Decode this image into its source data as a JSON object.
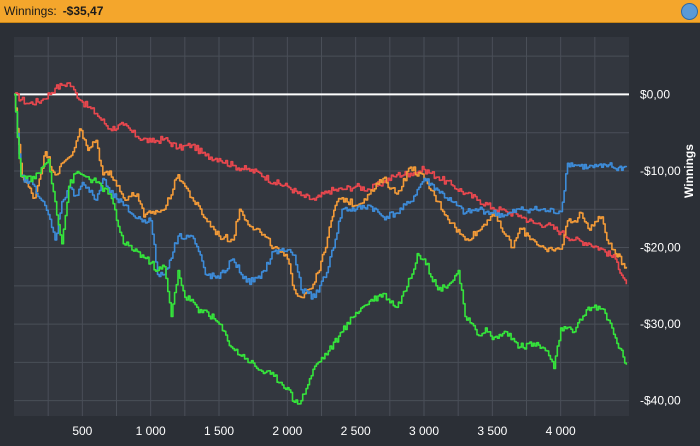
{
  "header": {
    "label": "Winnings:",
    "value": "-$35,47"
  },
  "colors": {
    "background": "#2b2f36",
    "plot_background": "#33373f",
    "grid": "#4a4f58",
    "zero_line": "#ffffff",
    "header": "#f4a62c"
  },
  "chart_data": {
    "type": "line",
    "title": "",
    "xlabel": "",
    "ylabel": "Winnings",
    "xlim": [
      0,
      4500
    ],
    "ylim": [
      -42,
      7.5
    ],
    "xticks": [
      500,
      1000,
      1500,
      2000,
      2500,
      3000,
      3500,
      4000
    ],
    "xtick_labels": [
      "500",
      "1 000",
      "1 500",
      "2 000",
      "2 500",
      "3 000",
      "3 500",
      "4 000"
    ],
    "yticks": [
      0,
      -10,
      -20,
      -30,
      -40
    ],
    "ytick_labels": [
      "$0,00",
      "-$10,00",
      "-$20,00",
      "-$30,00",
      "-$40,00"
    ],
    "grid": true,
    "zero_line": 0,
    "series": [
      {
        "color": "#e8474e",
        "x": [
          0,
          100,
          200,
          300,
          350,
          400,
          450,
          500,
          600,
          700,
          800,
          900,
          1000,
          1100,
          1200,
          1300,
          1400,
          1500,
          1600,
          1700,
          1800,
          1900,
          2000,
          2100,
          2200,
          2300,
          2400,
          2500,
          2600,
          2700,
          2800,
          2900,
          3000,
          3100,
          3200,
          3300,
          3400,
          3500,
          3600,
          3700,
          3800,
          3900,
          4000,
          4100,
          4200,
          4300,
          4400,
          4480
        ],
        "y": [
          0,
          -1.2,
          -0.8,
          0.8,
          1.2,
          1.5,
          0.2,
          -1,
          -2.5,
          -4.5,
          -4,
          -5.5,
          -6.2,
          -5.8,
          -7,
          -6.6,
          -8,
          -8.4,
          -9.3,
          -9.8,
          -10.3,
          -11.5,
          -12,
          -13.2,
          -13.8,
          -12.6,
          -12.4,
          -12,
          -12.4,
          -11.5,
          -10.5,
          -10.3,
          -9.8,
          -10.8,
          -11.8,
          -12.9,
          -13.8,
          -14.8,
          -15.3,
          -15.8,
          -16.8,
          -17,
          -18,
          -19,
          -19.4,
          -20.2,
          -21.5,
          -24.8
        ]
      },
      {
        "color": "#f29a38",
        "x": [
          0,
          60,
          150,
          230,
          300,
          380,
          430,
          480,
          540,
          600,
          650,
          700,
          800,
          900,
          950,
          1000,
          1100,
          1200,
          1250,
          1300,
          1400,
          1500,
          1600,
          1650,
          1700,
          1800,
          1900,
          2000,
          2050,
          2100,
          2150,
          2200,
          2280,
          2320,
          2350,
          2400,
          2500,
          2600,
          2700,
          2800,
          2900,
          3000,
          3100,
          3200,
          3300,
          3400,
          3500,
          3600,
          3650,
          3700,
          3800,
          3900,
          4000,
          4050,
          4100,
          4150,
          4200,
          4300,
          4350,
          4400,
          4480
        ],
        "y": [
          0,
          -10.8,
          -13.5,
          -7.5,
          -10.5,
          -8.5,
          -7.5,
          -4.5,
          -7.3,
          -6,
          -10.5,
          -10,
          -13.5,
          -13,
          -16,
          -15.5,
          -15,
          -10.5,
          -12,
          -13.5,
          -16.2,
          -18.5,
          -19,
          -15,
          -16.5,
          -18,
          -20,
          -21.5,
          -25.5,
          -26.5,
          -25.5,
          -24.5,
          -20,
          -16.5,
          -14.5,
          -13.5,
          -14.5,
          -13,
          -11,
          -13,
          -9.5,
          -11,
          -14,
          -16.8,
          -19,
          -17.8,
          -15.5,
          -18.5,
          -20,
          -17.5,
          -19,
          -20.5,
          -20.2,
          -16.5,
          -16.5,
          -15.5,
          -17.5,
          -16,
          -19.5,
          -20.8,
          -22.5
        ]
      },
      {
        "color": "#3d8bd8",
        "x": [
          0,
          50,
          150,
          250,
          300,
          350,
          400,
          450,
          500,
          600,
          650,
          700,
          800,
          900,
          1000,
          1050,
          1100,
          1200,
          1300,
          1350,
          1400,
          1500,
          1600,
          1700,
          1800,
          1900,
          2000,
          2050,
          2100,
          2200,
          2300,
          2400,
          2500,
          2600,
          2700,
          2800,
          2900,
          3000,
          3100,
          3200,
          3300,
          3400,
          3500,
          3600,
          3700,
          3800,
          3900,
          4000,
          4050,
          4100,
          4200,
          4300,
          4350,
          4400,
          4480
        ],
        "y": [
          0,
          -10.7,
          -12,
          -15.7,
          -19,
          -14,
          -12.2,
          -13.2,
          -11.5,
          -13.8,
          -11,
          -12.8,
          -14.5,
          -16.2,
          -16.5,
          -23.5,
          -23.5,
          -18.5,
          -18.5,
          -20.5,
          -23.5,
          -24,
          -21.5,
          -24.5,
          -24,
          -20.5,
          -20.3,
          -21,
          -25.5,
          -26.5,
          -22.5,
          -15,
          -15,
          -14.5,
          -16,
          -15.5,
          -14,
          -11,
          -12.5,
          -14,
          -15.5,
          -15,
          -15.5,
          -15.8,
          -15,
          -15,
          -15.2,
          -15.3,
          -9,
          -9.2,
          -9.5,
          -9.5,
          -9.2,
          -9.7,
          -9.5
        ]
      },
      {
        "color": "#35e43b",
        "x": [
          0,
          50,
          150,
          250,
          300,
          350,
          400,
          450,
          500,
          600,
          700,
          800,
          900,
          1000,
          1050,
          1100,
          1150,
          1200,
          1250,
          1300,
          1350,
          1400,
          1500,
          1600,
          1700,
          1800,
          1900,
          2000,
          2050,
          2100,
          2200,
          2300,
          2400,
          2500,
          2600,
          2700,
          2800,
          2900,
          2950,
          3000,
          3100,
          3200,
          3250,
          3300,
          3400,
          3450,
          3500,
          3600,
          3700,
          3800,
          3900,
          3950,
          4000,
          4100,
          4200,
          4300,
          4350,
          4400,
          4480
        ],
        "y": [
          0,
          -10.7,
          -11,
          -8.5,
          -14,
          -19.5,
          -12,
          -10.3,
          -10.5,
          -11.5,
          -13,
          -19.5,
          -20.5,
          -22,
          -23,
          -22.5,
          -29,
          -23,
          -26.5,
          -26.8,
          -28.5,
          -28.2,
          -30,
          -33.2,
          -34.5,
          -36,
          -36.8,
          -38.3,
          -40.2,
          -40,
          -35.5,
          -33.5,
          -31,
          -28.5,
          -27,
          -26,
          -27.8,
          -24,
          -20.8,
          -21.5,
          -25.5,
          -24.5,
          -23,
          -29,
          -31.5,
          -30.5,
          -32,
          -31,
          -33,
          -32.5,
          -33.5,
          -35.8,
          -30.5,
          -31,
          -27.8,
          -28,
          -29.5,
          -31.8,
          -35.3
        ]
      }
    ]
  }
}
